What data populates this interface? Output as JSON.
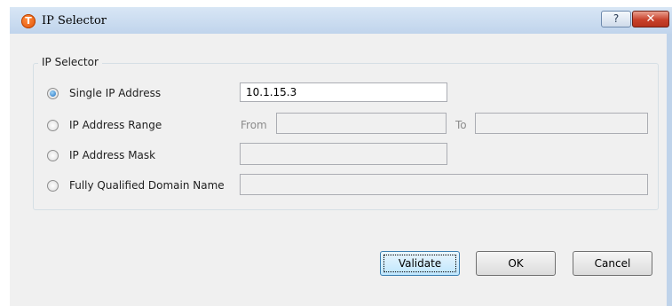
{
  "window": {
    "title": "IP Selector",
    "app_icon_glyph": "T",
    "help_glyph": "?",
    "close_glyph": "✕"
  },
  "group": {
    "title": "IP Selector"
  },
  "options": {
    "single_ip": {
      "label": "Single IP Address",
      "value": "10.1.15.3",
      "selected": true
    },
    "ip_range": {
      "label": "IP Address Range",
      "from_label": "From",
      "to_label": "To",
      "from_value": "",
      "to_value": ""
    },
    "ip_mask": {
      "label": "IP Address Mask",
      "value": ""
    },
    "fqdn": {
      "label": "Fully Qualified Domain Name",
      "value": ""
    }
  },
  "buttons": {
    "validate": "Validate",
    "ok": "OK",
    "cancel": "Cancel"
  },
  "colors": {
    "title_bar": "#c8d9ee",
    "close_button": "#c8412b",
    "radio_selected": "#1e6fc1"
  }
}
